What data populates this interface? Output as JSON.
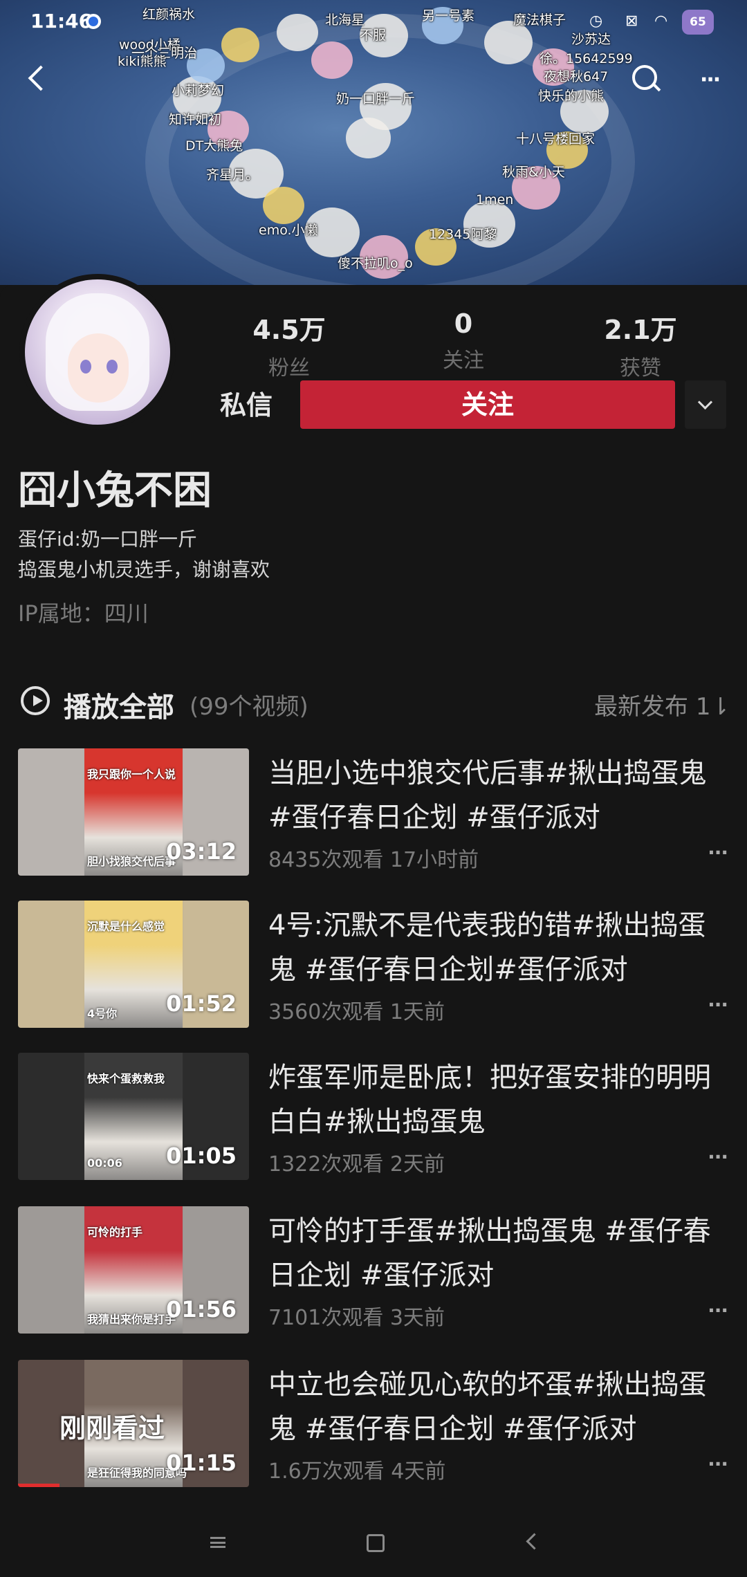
{
  "status_bar": {
    "time": "11:46",
    "battery": "65"
  },
  "banner": {
    "danmaku": [
      "红颜祸水",
      "wood小橘",
      "一个三明治",
      "kiki熊熊",
      "小莉梦幻",
      "知许如初",
      "DT大熊兔",
      "齐星月。",
      "emo.小懒",
      "奶一口胖一斤",
      "傻不拉叽o_o",
      "12345阿黎",
      "1men",
      "秋雨&小天",
      "十八号楼回家",
      "快乐的小熊",
      "夜想秋647",
      "徐。15642599",
      "沙苏达",
      "魔法棋子",
      "另一号素",
      "北海星",
      "不服"
    ]
  },
  "profile": {
    "stats": [
      {
        "value": "4.5万",
        "label": "粉丝"
      },
      {
        "value": "0",
        "label": "关注"
      },
      {
        "value": "2.1万",
        "label": "获赞"
      }
    ],
    "message_button": "私信",
    "follow_button": "关注",
    "name": "囧小兔不困",
    "bio_line1": "蛋仔id:奶一口胖一斤",
    "bio_line2": "捣蛋鬼小机灵选手，谢谢喜欢",
    "ip": "IP属地：四川"
  },
  "section": {
    "play_all": "播放全部",
    "count": "(99个视频)",
    "sort": "最新发布 1⇂"
  },
  "videos": [
    {
      "title": "当胆小选中狼交代后事#揪出捣蛋鬼 #蛋仔春日企划 #蛋仔派对",
      "views": "8435次观看",
      "age": "17小时前",
      "duration": "03:12",
      "caption_top": "我只跟你一个人说",
      "caption_bottom": "胆小找狼交代后事",
      "colors": {
        "bg": "#b9b4b0",
        "inner": "#d7362e"
      }
    },
    {
      "title": "4号:沉默不是代表我的错#揪出捣蛋鬼 #蛋仔春日企划#蛋仔派对",
      "views": "3560次观看",
      "age": "1天前",
      "duration": "01:52",
      "caption_top": "沉默是什么感觉",
      "caption_bottom": "4号你",
      "colors": {
        "bg": "#c9b996",
        "inner": "#efd27a"
      }
    },
    {
      "title": "炸蛋军师是卧底！把好蛋安排的明明白白#揪出捣蛋鬼",
      "views": "1322次观看",
      "age": "2天前",
      "duration": "01:05",
      "caption_top": "快来个蛋救救我",
      "caption_bottom": "00:06",
      "colors": {
        "bg": "#2c2c2c",
        "inner": "#3a3a3a"
      }
    },
    {
      "title": "可怜的打手蛋#揪出捣蛋鬼 #蛋仔春日企划 #蛋仔派对",
      "views": "7101次观看",
      "age": "3天前",
      "duration": "01:56",
      "caption_top": "可怜的打手",
      "caption_bottom": "我猜出来你是打手",
      "colors": {
        "bg": "#9e9a97",
        "inner": "#c5333d"
      }
    },
    {
      "title": "中立也会碰见心软的坏蛋#揪出捣蛋鬼 #蛋仔春日企划 #蛋仔派对",
      "views": "1.6万次观看",
      "age": "4天前",
      "duration": "01:15",
      "caption_top": "",
      "caption_bottom": "是狂征得我的同意吗",
      "seen_label": "刚刚看过",
      "watched_fraction": 0.18,
      "colors": {
        "bg": "#5a4a45",
        "inner": "#7a6a60"
      }
    }
  ]
}
